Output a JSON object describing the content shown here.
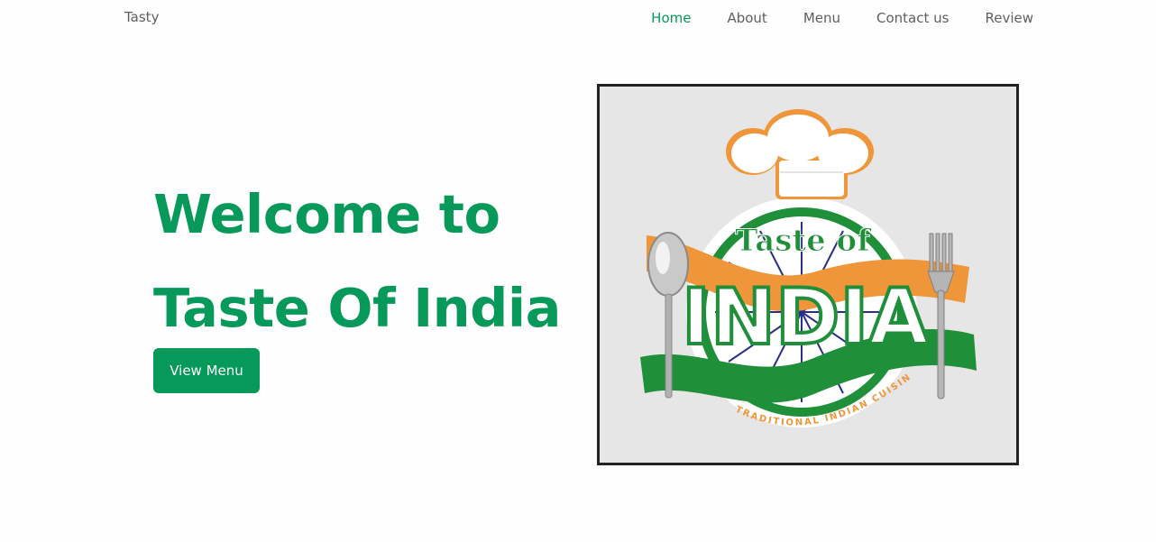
{
  "navbar": {
    "brand": "Tasty",
    "links": [
      {
        "label": "Home",
        "active": true
      },
      {
        "label": "About"
      },
      {
        "label": "Menu"
      },
      {
        "label": "Contact us"
      },
      {
        "label": "Review"
      }
    ]
  },
  "hero": {
    "title_line1": "Welcome to",
    "title_line2": "Taste Of India",
    "button_label": "View Menu"
  },
  "logo": {
    "top_text": "Taste of",
    "main_text": "INDIA",
    "tagline": "TRADITIONAL INDIAN CUISINE"
  },
  "colors": {
    "accent": "#07995a",
    "saffron": "#f0963a",
    "indian_green": "#1f8f3a",
    "chakra_blue": "#2a2f8a"
  }
}
